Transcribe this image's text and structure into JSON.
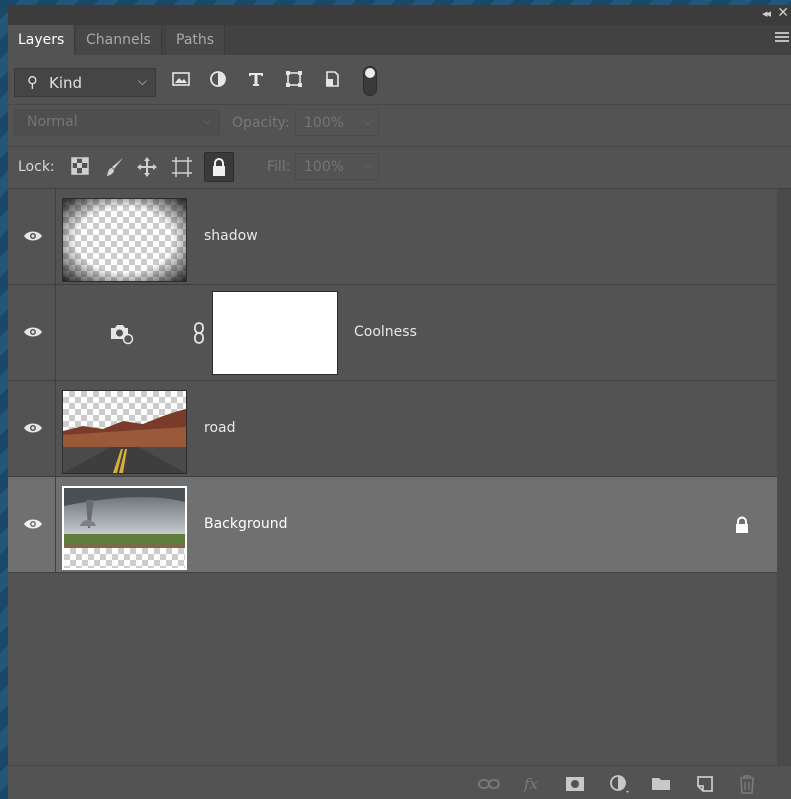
{
  "tabs": [
    {
      "label": "Layers",
      "active": true
    },
    {
      "label": "Channels",
      "active": false
    },
    {
      "label": "Paths",
      "active": false
    }
  ],
  "filter": {
    "kind_label": "Kind",
    "icons": [
      "image-filter-icon",
      "adjustment-filter-icon",
      "type-filter-icon",
      "shape-filter-icon",
      "smart-object-filter-icon"
    ]
  },
  "blend": {
    "mode": "Normal",
    "opacity_label": "Opacity:",
    "opacity_value": "100%"
  },
  "lock": {
    "label": "Lock:",
    "fill_label": "Fill:",
    "fill_value": "100%"
  },
  "layers": [
    {
      "name": "shadow",
      "visible": true,
      "type": "pixel",
      "thumb": "vignette"
    },
    {
      "name": "Coolness",
      "visible": true,
      "type": "adjustment",
      "thumb": "mask-white"
    },
    {
      "name": "road",
      "visible": true,
      "type": "pixel",
      "thumb": "road"
    },
    {
      "name": "Background",
      "visible": true,
      "type": "pixel",
      "thumb": "tornado",
      "selected": true,
      "locked": true
    }
  ],
  "colors": {
    "panel": "#535353",
    "selected_row": "#707070",
    "accent_text": "#ffffff"
  }
}
